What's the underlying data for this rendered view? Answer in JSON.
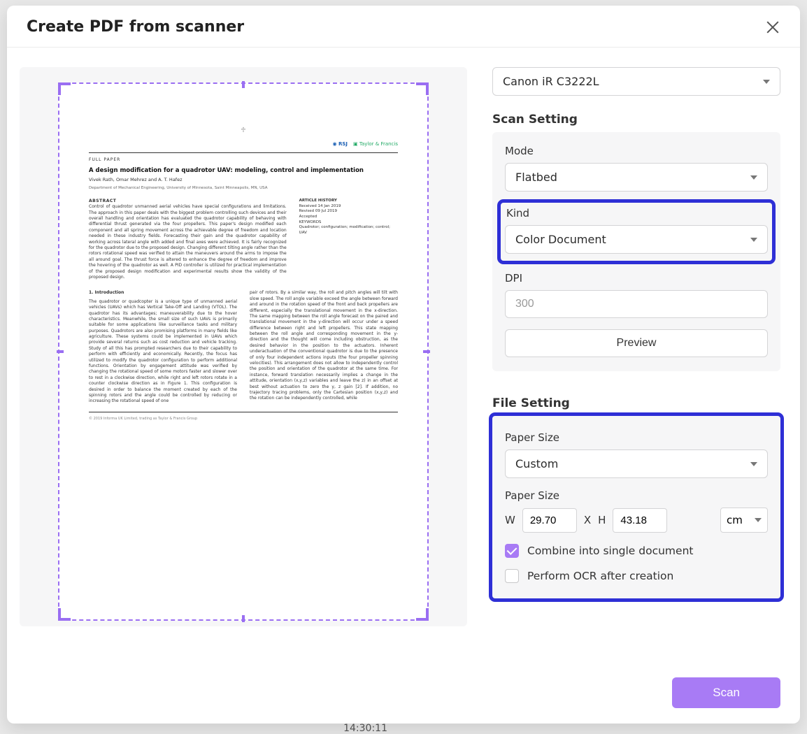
{
  "dialog": {
    "title": "Create PDF from scanner"
  },
  "scanner": {
    "selected": "Canon iR C3222L"
  },
  "scanSetting": {
    "heading": "Scan Setting",
    "mode": {
      "label": "Mode",
      "value": "Flatbed"
    },
    "kind": {
      "label": "Kind",
      "value": "Color Document"
    },
    "dpi": {
      "label": "DPI",
      "value": "300"
    },
    "previewBtn": "Preview"
  },
  "fileSetting": {
    "heading": "File Setting",
    "paperSizeSelect": {
      "label": "Paper Size",
      "value": "Custom"
    },
    "paperSizeDims": {
      "label": "Paper Size",
      "wLabel": "W",
      "w": "29.70",
      "xLabel": "X",
      "hLabel": "H",
      "h": "43.18",
      "unit": "cm"
    },
    "combine": {
      "label": "Combine into single document",
      "checked": true
    },
    "ocr": {
      "label": "Perform OCR after creation",
      "checked": false
    }
  },
  "footer": {
    "scan": "Scan"
  },
  "previewDoc": {
    "journal": "FULL PAPER",
    "title": "A design modification for a quadrotor UAV: modeling, control and implementation",
    "authors": "Vivek Rath, Omar Mehrez and A. T. Hafez",
    "affiliation": "Department of Mechanical Engineering, University of Minnesota, Saint Minneapolis, MN, USA",
    "abstractHead": "ABSTRACT",
    "abstract": "Control of quadrotor unmanned aerial vehicles have special configurations and limitations. The approach in this paper deals with the biggest problem controlling such devices and their overall handling and orientation has evaluated the quadrotor capability of behaving with differential thrust generated via the four propellers. This paper's design modified each component and all spring movement across the achievable degree of freedom and location needed in these industry fields. Forecasting their gain and the quadrotor capability of working across lateral angle with added and final axes were achieved. It is fairly recognized for the quadrotor due to the proposed design. Changing different tilting angle rather than the rotors rotational speed was verified to attain the maneuvers around the arms to impose the all around goal. The thrust force is altered to enhance the degree of freedom and improve the hovering of the quadrotor as well. A PID controller is utilized for practical implementation of the proposed design modification and experimental results show the validity of the proposed design.",
    "infoHead": "ARTICLE HISTORY",
    "info": "Received 14 Jan 2019\nRevised 09 Jul 2019\nAccepted\nKEYWORDS\nQuadrotor; configuration; modification; control; UAV",
    "secHead": "1. Introduction",
    "col1": "The quadrotor or quadcopter is a unique type of unmanned aerial vehicles (UAVs) which has Vertical Take-Off and Landing (VTOL). The quadrotor has its advantages; maneuverability due to the hover characteristics. Meanwhile, the small size of such UAVs is primarily suitable for some applications like surveillance tasks and military purposes. Quadrotors are also promising platforms in many fields like agriculture. These systems could be implemented in UAVs which provide several returns such as cost reduction and vehicle tracking. Study of all this has prompted researchers due to their capability to perform with efficiently and economically. Recently, the focus has utilized to modify the quadrotor configuration to perform additional functions. Orientation by engagement attitude was verified by changing the rotational speed of some motors faster and slower over to rest in a clockwise direction, while right and left rotors rotate in a counter clockwise direction as in Figure 1. This configuration is desired in order to balance the moment created by each of the spinning rotors and the angle could be controlled by reducing or increasing the rotational speed of one",
    "col2": "pair of rotors. By a similar way, the roll and pitch angles will tilt with slow speed. The roll angle variable exceed the angle between forward and around in the rotation speed of the front and back propellers are different, especially the translational movement in the x-direction. The same mapping between the roll angle forecast on the paired and translational movement in the y-direction will occur under a speed difference between right and left propellers. This state mapping between the roll angle and corresponding movement in the y-direction and the thought will come including obstruction, as the desired behavior in the position to the actuators. Inherent underactuation of the conventional quadrotor is due to the presence of only four independent actions inputs (the four propeller spinning velocities). This arrangement does not allow to independently control the position and orientation of the quadrotor at the same time. For instance, forward translation necessarily implies a change in the attitude, orientation (x,y,z) variables and leave the z) in an offset at best without actuation to zero the y, z gain [2]. If addition, no trajectory tracing problems, only the Cartesian position (x,y,z) and the rotation can be independently controlled, while",
    "footnote": "© 2019 Informa UK Limited, trading as Taylor & Francis Group"
  },
  "background": {
    "time": "14:30:11"
  },
  "colors": {
    "accent": "#a87bf5",
    "highlight": "#2e2fd6"
  }
}
